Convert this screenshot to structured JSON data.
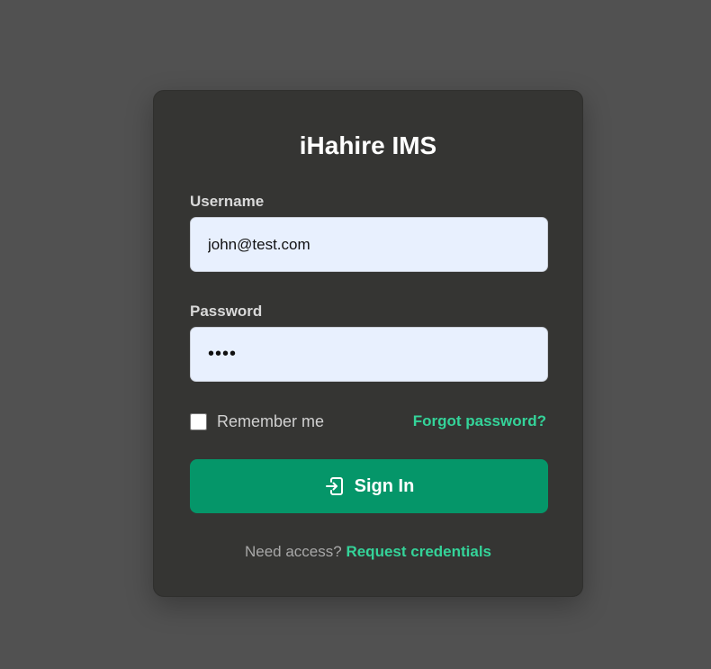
{
  "login": {
    "title": "iHahire IMS",
    "username": {
      "label": "Username",
      "value": "john@test.com"
    },
    "password": {
      "label": "Password",
      "value": "test"
    },
    "remember_label": "Remember me",
    "remember_checked": false,
    "forgot_label": "Forgot password?",
    "signin_label": "Sign In",
    "signin_icon": "sign-in-icon",
    "access_text": "Need access?",
    "access_link": "Request credentials"
  },
  "colors": {
    "background": "#515151",
    "card": "#353533",
    "accent": "#34d399",
    "button": "#059669",
    "input_fill": "#e8f0fe"
  }
}
